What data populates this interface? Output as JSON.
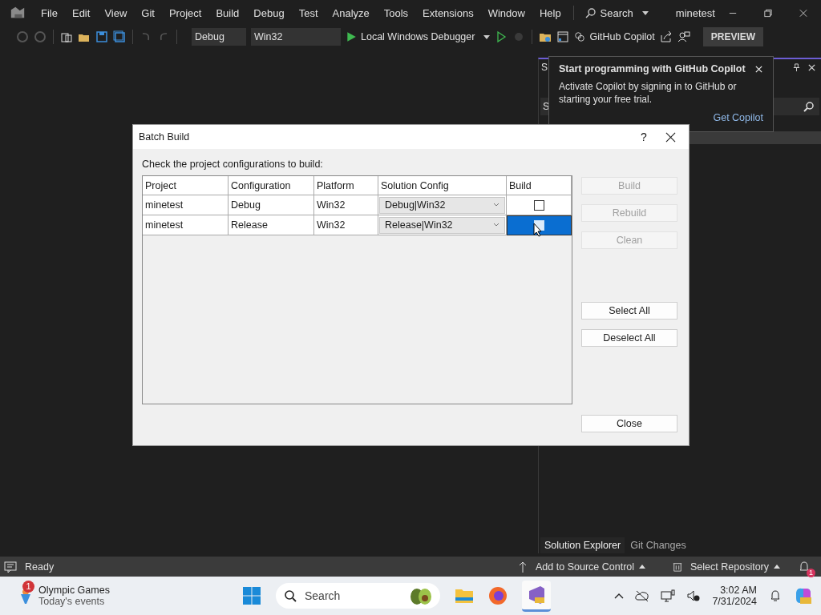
{
  "app": {
    "title": "minetest"
  },
  "menu": [
    "File",
    "Edit",
    "View",
    "Git",
    "Project",
    "Build",
    "Debug",
    "Test",
    "Analyze",
    "Tools",
    "Extensions",
    "Window",
    "Help"
  ],
  "search": {
    "label": "Search"
  },
  "toolbar": {
    "configuration": "Debug",
    "platform": "Win32",
    "debugger": "Local Windows Debugger",
    "copilot": "GitHub Copilot",
    "preview": "PREVIEW"
  },
  "copilot_tip": {
    "title": "Start programming with GitHub Copilot",
    "message": "Activate Copilot by signing in to GitHub or starting your free trial.",
    "link": "Get Copilot"
  },
  "solution_explorer": {
    "title": "S",
    "search": "S",
    "tabs": [
      {
        "label": "Solution Explorer",
        "selected": true
      },
      {
        "label": "Git Changes",
        "selected": false
      }
    ]
  },
  "dialog": {
    "title": "Batch Build",
    "help": "?",
    "instruction": "Check the project configurations to build:",
    "columns": [
      "Project",
      "Configuration",
      "Platform",
      "Solution Config",
      "Build"
    ],
    "rows": [
      {
        "project": "minetest",
        "configuration": "Debug",
        "platform": "Win32",
        "solution_config": "Debug|Win32",
        "build": false,
        "selected": false
      },
      {
        "project": "minetest",
        "configuration": "Release",
        "platform": "Win32",
        "solution_config": "Release|Win32",
        "build": false,
        "selected": true
      }
    ],
    "action_buttons": [
      {
        "label": "Build",
        "disabled": true
      },
      {
        "label": "Rebuild",
        "disabled": true
      },
      {
        "label": "Clean",
        "disabled": true
      }
    ],
    "selection_buttons": [
      {
        "label": "Select All",
        "disabled": false
      },
      {
        "label": "Deselect All",
        "disabled": false
      }
    ],
    "close_button": {
      "label": "Close",
      "disabled": false
    }
  },
  "status_bar": {
    "message": "Ready",
    "source_control": "Add to Source Control",
    "repository": "Select Repository",
    "notifications": "1"
  },
  "taskbar": {
    "widget": {
      "title": "Olympic Games",
      "subtitle": "Today's events",
      "badge": "1"
    },
    "search": "Search",
    "time": "3:02 AM",
    "date": "7/31/2024"
  }
}
